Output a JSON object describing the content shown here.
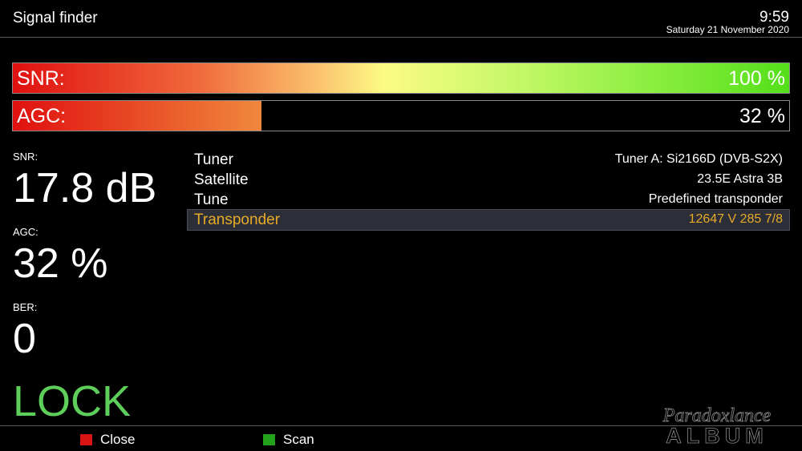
{
  "header": {
    "title": "Signal finder",
    "time": "9:59",
    "date": "Saturday 21 November 2020"
  },
  "bars": {
    "snr": {
      "label": "SNR:",
      "value_text": "100 %",
      "level": 1.0
    },
    "agc": {
      "label": "AGC:",
      "value_text": "32 %",
      "level": 0.32
    }
  },
  "stats": {
    "snr": {
      "label": "SNR:",
      "value": "17.8 dB"
    },
    "agc": {
      "label": "AGC:",
      "value": "32 %"
    },
    "ber": {
      "label": "BER:",
      "value": "0"
    },
    "lock": "LOCK"
  },
  "info": [
    {
      "key": "Tuner",
      "value": "Tuner A: Si2166D (DVB-S2X)"
    },
    {
      "key": "Satellite",
      "value": "23.5E Astra 3B"
    },
    {
      "key": "Tune",
      "value": "Predefined transponder"
    },
    {
      "key": "Transponder",
      "value": "12647 V 285 7/8",
      "selected": true
    }
  ],
  "footer": {
    "close": "Close",
    "scan": "Scan"
  },
  "watermark": {
    "line1": "Paradoxlance",
    "line2": "ALBUM"
  },
  "colors": {
    "lock": "#5dce5a",
    "selected_text": "#e7aa26",
    "red_key": "#d81414",
    "green_key": "#22a21a"
  }
}
